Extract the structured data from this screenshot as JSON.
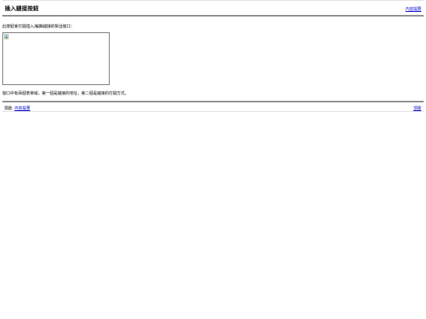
{
  "header": {
    "title": "插入鏈接按鈕",
    "contents_link": "內容提要"
  },
  "main": {
    "intro_text": "此按鈕會打開插入/編輯鏈接的對話窗口：",
    "caption_text": "窗口中有兩個表單域，第一個是鏈接的地址，第二個是鏈接的打開方式。"
  },
  "footer": {
    "left_label": "頂層:",
    "left_link": "內容提要",
    "right_link": "頂層"
  },
  "icons": {
    "broken_image": "broken-image-icon"
  },
  "colors": {
    "link": "#0000cc",
    "rule": "#8c8c8c"
  }
}
